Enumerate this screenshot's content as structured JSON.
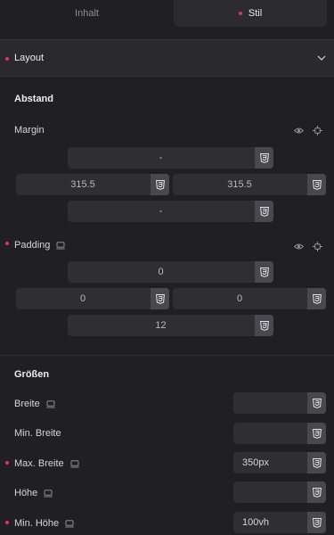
{
  "tabs": {
    "content": "Inhalt",
    "style": "Stil"
  },
  "layout_section": {
    "label": "Layout"
  },
  "spacing": {
    "heading": "Abstand",
    "margin": {
      "label": "Margin",
      "top": "-",
      "left": "315.5",
      "right": "315.5",
      "bottom": "-"
    },
    "padding": {
      "label": "Padding",
      "top": "0",
      "left": "0",
      "right": "0",
      "bottom": "12"
    }
  },
  "sizes": {
    "heading": "Größen",
    "width": {
      "label": "Breite",
      "value": ""
    },
    "min_width": {
      "label": "Min. Breite",
      "value": ""
    },
    "max_width": {
      "label": "Max. Breite",
      "value": "350px"
    },
    "height": {
      "label": "Höhe",
      "value": ""
    },
    "min_height": {
      "label": "Min. Höhe",
      "value": "100vh"
    }
  },
  "colors": {
    "accent": "#e0306f",
    "background": "#202023",
    "field": "#2e2e33",
    "unit_button": "#48484e"
  },
  "icons": [
    "css-unit-icon",
    "eye-icon",
    "crosshair-icon",
    "desktop-icon",
    "chevron-down-icon"
  ]
}
